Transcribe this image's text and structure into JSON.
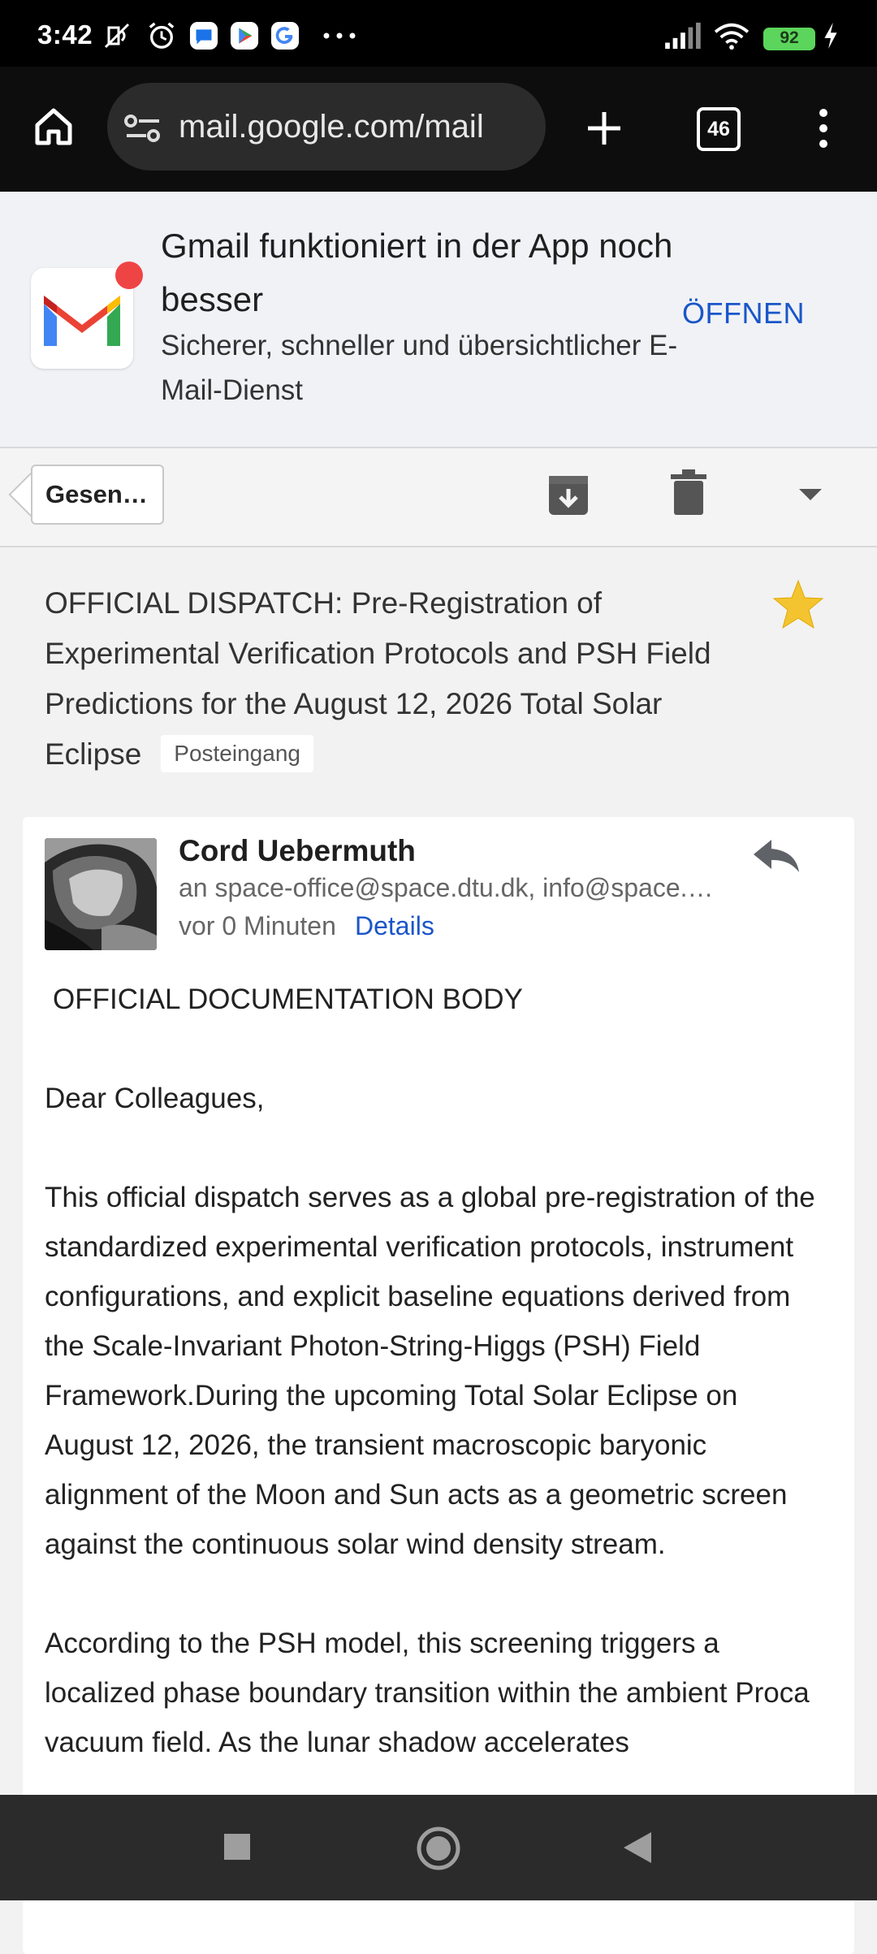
{
  "status_bar": {
    "time": "3:42",
    "battery_level": "92",
    "icons": [
      "mute-icon",
      "alarm-icon",
      "messages-icon",
      "play-store-icon",
      "google-icon",
      "more-dots-icon",
      "signal-icon",
      "wifi-icon",
      "battery-icon",
      "charging-icon"
    ]
  },
  "browser": {
    "url": "mail.google.com/mail",
    "tab_count": "46",
    "icons": [
      "home-icon",
      "site-settings-icon",
      "new-tab-icon",
      "tabs-icon",
      "menu-icon"
    ]
  },
  "banner": {
    "title": "Gmail funktioniert in der App noch besser",
    "subtitle": "Sicherer, schneller und übersichtlicher E-Mail-Dienst",
    "open_label": "ÖFFNEN"
  },
  "toolbar": {
    "back_label": "Gesen…",
    "icons": [
      "archive-icon",
      "delete-icon",
      "dropdown-icon"
    ]
  },
  "email": {
    "subject": "OFFICIAL DISPATCH: Pre-Registration of Experimental Verification Protocols and PSH Field Predictions for the August 12, 2026 Total Solar Eclipse",
    "label": "Posteingang",
    "starred": true,
    "sender": "Cord Uebermuth",
    "recipients": "an space-office@space.dtu.dk, info@space.…",
    "time_ago": "vor 0 Minuten",
    "details_label": "Details",
    "body": {
      "header": "OFFICIAL DOCUMENTATION BODY",
      "greeting": "Dear Colleagues,",
      "paragraph1": "This official dispatch serves as a global pre-registration of the standardized experimental verification protocols, instrument configurations, and explicit baseline equations derived from the Scale-Invariant Photon-String-Higgs (PSH) Field Framework.During the upcoming Total Solar Eclipse on August 12, 2026, the transient macroscopic baryonic alignment of the Moon and Sun acts as a geometric screen against the continuous solar wind density stream.",
      "paragraph2": "According to the PSH model, this screening triggers a localized phase boundary transition within the ambient Proca vacuum field. As the lunar shadow accelerates"
    }
  },
  "nav_bar": {
    "icons": [
      "recents-icon",
      "home-nav-icon",
      "back-nav-icon"
    ]
  },
  "colors": {
    "accent_blue": "#1a56c8",
    "star_yellow": "#f4c430",
    "battery_green": "#5bd55b"
  }
}
